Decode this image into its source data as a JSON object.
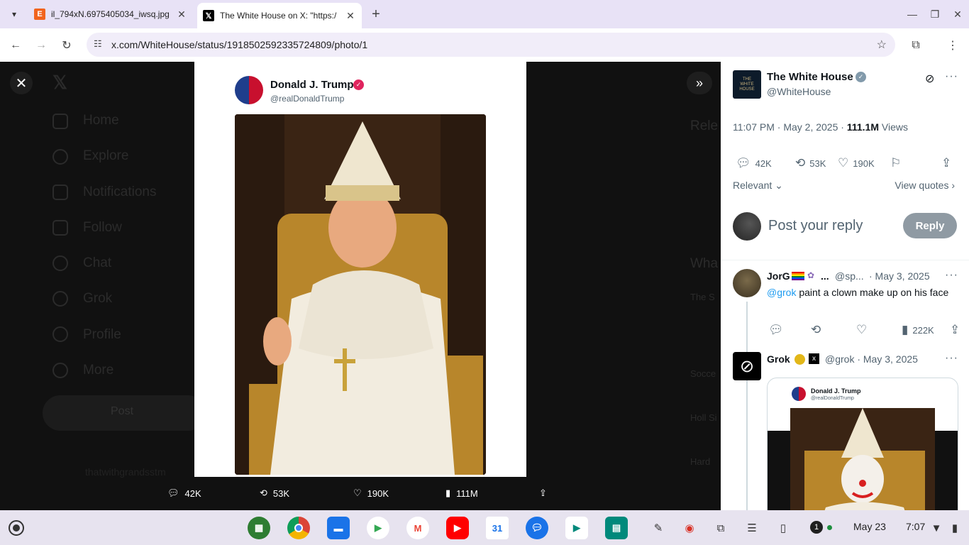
{
  "browser": {
    "tabs": [
      {
        "title": "il_794xN.6975405034_iwsq.jpg",
        "favicon": "etsy-icon",
        "active": false
      },
      {
        "title": "The White House on X: \"https:/",
        "favicon": "x-icon",
        "active": true
      }
    ],
    "url": "x.com/WhiteHouse/status/1918502592335724809/photo/1"
  },
  "photo_card": {
    "author_name": "Donald J. Trump",
    "author_handle": "@realDonaldTrump"
  },
  "photo_actions": {
    "replies": "42K",
    "reposts": "53K",
    "likes": "190K",
    "views": "111M"
  },
  "sidebar_ghost": [
    "Home",
    "Explore",
    "Notifications",
    "Follow",
    "Chat",
    "Grok",
    "Profile",
    "More"
  ],
  "sidebar_post_label": "Post",
  "sidebar_user": "thatwithgrandsstm",
  "right_ghost": [
    "Rele",
    "Wha",
    "The S",
    "Socce",
    "Holl Si",
    "Hard"
  ],
  "panel": {
    "account_name": "The White House",
    "account_handle": "@WhiteHouse",
    "time": "11:07 PM · May 2, 2025 · ",
    "views_count": "111.1M",
    "views_label": " Views",
    "replies": "42K",
    "reposts": "53K",
    "likes": "190K",
    "sort_label": "Relevant",
    "view_quotes": "View quotes",
    "reply_placeholder": "Post your reply",
    "reply_button": "Reply",
    "reply1": {
      "name": "JorG",
      "ellipsis": "...",
      "handle": "@sp...",
      "date": "· May 3, 2025",
      "mention": "@grok",
      "text": " paint a clown make up on his face",
      "views": "222K"
    },
    "reply2": {
      "name": "Grok",
      "handle": "@grok · May 3, 2025",
      "embed_name": "Donald J. Trump",
      "embed_handle": "@realDonaldTrump"
    }
  },
  "shelf": {
    "notif_count": "1",
    "date": "May 23",
    "time": "7:07"
  }
}
